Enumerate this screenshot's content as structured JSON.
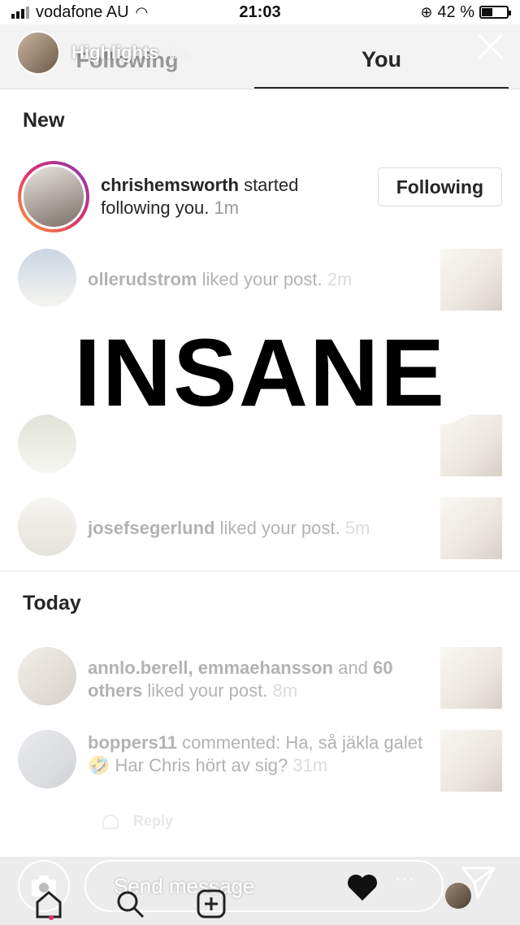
{
  "status": {
    "carrier": "vodafone AU",
    "time": "21:03",
    "battery": "42 %",
    "battery_level": 0.42
  },
  "story": {
    "title": "Highlights",
    "age": "8w"
  },
  "tabs": [
    {
      "label": "Following"
    },
    {
      "label": "You"
    }
  ],
  "sections": {
    "new": "New",
    "today": "Today"
  },
  "notifications_new": [
    {
      "user": "chrishemsworth",
      "action": "started following you.",
      "time": "1m",
      "button": "Following"
    },
    {
      "user": "ollerudstrom",
      "action": "liked your post.",
      "time": "2m"
    },
    {
      "user": "josefsegerlund",
      "action": "liked your post.",
      "time": "5m"
    }
  ],
  "notifications_today": [
    {
      "user": "annlo.berell, emmaehansson",
      "action": "and",
      "others": "60 others",
      "action2": "liked your post.",
      "time": "8m"
    },
    {
      "user": "boppers11",
      "action": "commented: Ha, så jäkla galet 🤣 Har Chris hört av sig?",
      "time": "31m"
    }
  ],
  "reply_label": "Reply",
  "overlay_text": "INSANE",
  "bottom": {
    "send_placeholder": "Send message",
    "more": "···"
  }
}
